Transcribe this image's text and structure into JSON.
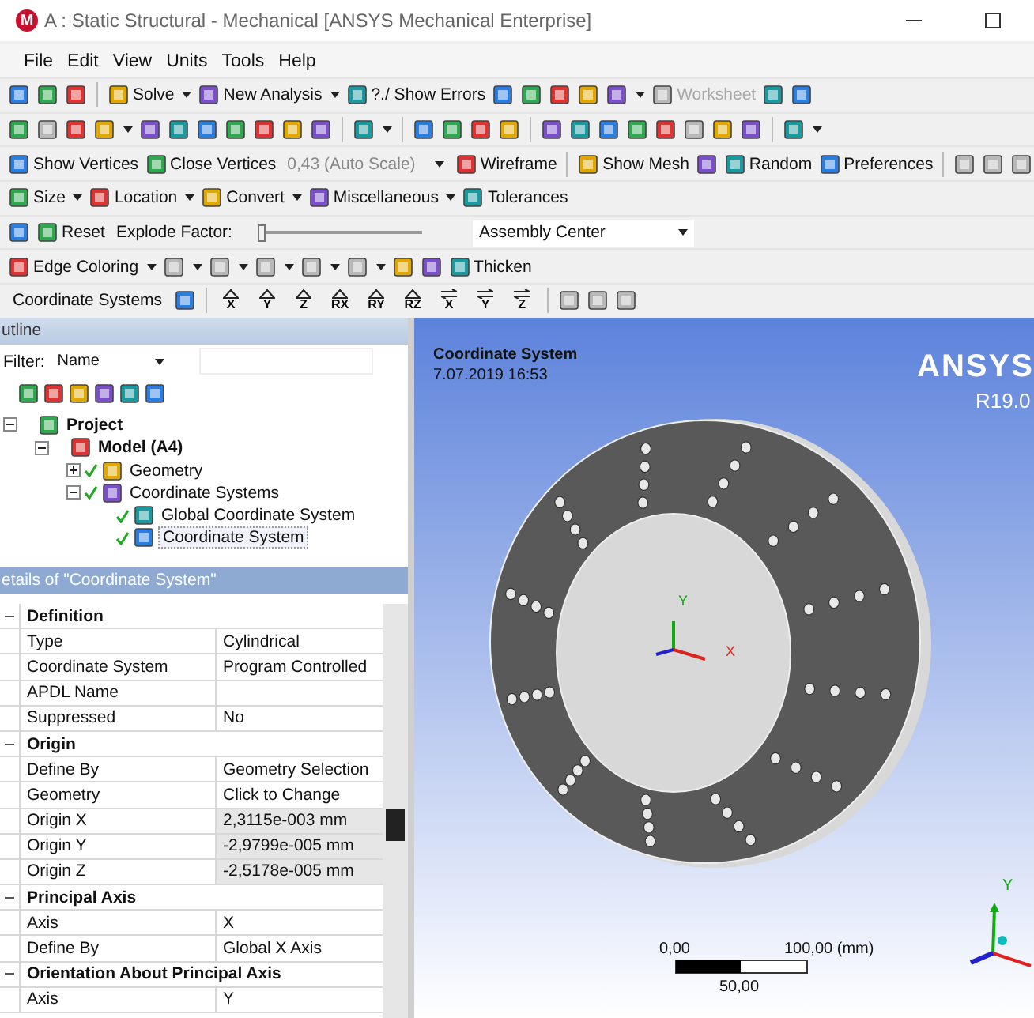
{
  "window": {
    "app_icon_letter": "M",
    "title": "A : Static Structural - Mechanical [ANSYS Mechanical Enterprise]"
  },
  "menu": [
    "File",
    "Edit",
    "View",
    "Units",
    "Tools",
    "Help"
  ],
  "toolbars": [
    [
      {
        "kind": "button"
      },
      {
        "kind": "button"
      },
      {
        "kind": "button"
      },
      {
        "kind": "separator"
      },
      {
        "kind": "button",
        "label": "Solve",
        "dropdown": true
      },
      {
        "kind": "button",
        "label": "New Analysis",
        "dropdown": true
      },
      {
        "kind": "button",
        "label": "?./ Show Errors"
      },
      {
        "kind": "button"
      },
      {
        "kind": "button"
      },
      {
        "kind": "button"
      },
      {
        "kind": "button"
      },
      {
        "kind": "button",
        "dropdown": true
      },
      {
        "kind": "button",
        "label": "Worksheet",
        "disabled": true
      },
      {
        "kind": "button"
      },
      {
        "kind": "button"
      }
    ],
    [
      {
        "kind": "button"
      },
      {
        "kind": "button",
        "disabled": true
      },
      {
        "kind": "button"
      },
      {
        "kind": "button",
        "dropdown": true
      },
      {
        "kind": "button"
      },
      {
        "kind": "button"
      },
      {
        "kind": "button"
      },
      {
        "kind": "button"
      },
      {
        "kind": "button"
      },
      {
        "kind": "button"
      },
      {
        "kind": "button"
      },
      {
        "kind": "separator"
      },
      {
        "kind": "button",
        "dropdown": true
      },
      {
        "kind": "separator"
      },
      {
        "kind": "button"
      },
      {
        "kind": "button"
      },
      {
        "kind": "button"
      },
      {
        "kind": "button"
      },
      {
        "kind": "separator"
      },
      {
        "kind": "button"
      },
      {
        "kind": "button"
      },
      {
        "kind": "button"
      },
      {
        "kind": "button"
      },
      {
        "kind": "button"
      },
      {
        "kind": "button",
        "disabled": true
      },
      {
        "kind": "button"
      },
      {
        "kind": "button"
      },
      {
        "kind": "separator"
      },
      {
        "kind": "button",
        "dropdown": true
      }
    ],
    [
      {
        "kind": "button",
        "label": "Show Vertices"
      },
      {
        "kind": "button",
        "label": "Close Vertices"
      },
      {
        "kind": "combo",
        "value": "0,43 (Auto Scale)",
        "disabled": true
      },
      {
        "kind": "button",
        "label": "Wireframe"
      },
      {
        "kind": "separator"
      },
      {
        "kind": "button",
        "label": "Show Mesh"
      },
      {
        "kind": "button"
      },
      {
        "kind": "button",
        "label": "Random"
      },
      {
        "kind": "button",
        "label": "Preferences"
      },
      {
        "kind": "separator"
      },
      {
        "kind": "button",
        "disabled": true
      },
      {
        "kind": "button",
        "disabled": true
      },
      {
        "kind": "button",
        "disabled": true
      }
    ],
    [
      {
        "kind": "button",
        "label": "Size",
        "dropdown": true
      },
      {
        "kind": "button",
        "label": "Location",
        "dropdown": true
      },
      {
        "kind": "button",
        "label": "Convert",
        "dropdown": true
      },
      {
        "kind": "button",
        "label": "Miscellaneous",
        "dropdown": true
      },
      {
        "kind": "button",
        "label": "Tolerances"
      }
    ],
    [
      {
        "kind": "button"
      },
      {
        "kind": "button",
        "label": "Reset"
      },
      {
        "kind": "text",
        "label": "Explode Factor:"
      },
      {
        "kind": "slider",
        "level": 0
      },
      {
        "kind": "combo",
        "value": "Assembly Center"
      }
    ],
    [
      {
        "kind": "button",
        "label": "Edge Coloring",
        "dropdown": true
      },
      {
        "kind": "button",
        "dropdown": true,
        "disabled": true
      },
      {
        "kind": "button",
        "dropdown": true,
        "disabled": true
      },
      {
        "kind": "button",
        "dropdown": true,
        "disabled": true
      },
      {
        "kind": "button",
        "dropdown": true,
        "disabled": true
      },
      {
        "kind": "button",
        "dropdown": true,
        "disabled": true
      },
      {
        "kind": "button"
      },
      {
        "kind": "button"
      },
      {
        "kind": "button",
        "label": "Thicken"
      }
    ],
    [
      {
        "kind": "text",
        "label": "Coordinate Systems"
      },
      {
        "kind": "button"
      },
      {
        "kind": "separator"
      },
      {
        "kind": "axis",
        "label": "X"
      },
      {
        "kind": "axis",
        "label": "Y"
      },
      {
        "kind": "axis",
        "label": "Z"
      },
      {
        "kind": "axis",
        "label": "RX"
      },
      {
        "kind": "axis",
        "label": "RY"
      },
      {
        "kind": "axis",
        "label": "RZ"
      },
      {
        "kind": "flip",
        "label": "X"
      },
      {
        "kind": "flip",
        "label": "Y"
      },
      {
        "kind": "flip",
        "label": "Z"
      },
      {
        "kind": "separator"
      },
      {
        "kind": "button",
        "disabled": true
      },
      {
        "kind": "button",
        "disabled": true
      },
      {
        "kind": "button",
        "disabled": true
      }
    ]
  ],
  "outline": {
    "title": "utline",
    "filter_label": "Filter:",
    "filter_value": "Name",
    "tree": [
      {
        "label": "Project",
        "selected": false,
        "expanded": true,
        "children": [
          {
            "label": "Model (A4)",
            "selected": false,
            "expanded": true,
            "children": [
              {
                "label": "Geometry",
                "checked": true,
                "selected": false,
                "expanded": false
              },
              {
                "label": "Coordinate Systems",
                "checked": true,
                "selected": false,
                "expanded": true,
                "children": [
                  {
                    "label": "Global Coordinate System",
                    "checked": true,
                    "selected": false
                  },
                  {
                    "label": "Coordinate System",
                    "checked": true,
                    "selected": true
                  }
                ]
              }
            ]
          }
        ]
      }
    ]
  },
  "details": {
    "title": "etails of \"Coordinate System\"",
    "sections": [
      {
        "name": "Definition",
        "expanded": true,
        "rows": [
          {
            "name": "Type",
            "value": "Cylindrical",
            "shaded": false
          },
          {
            "name": "Coordinate System",
            "value": "Program Controlled",
            "shaded": false
          },
          {
            "name": "APDL Name",
            "shaded": false
          },
          {
            "name": "Suppressed",
            "value": "No",
            "shaded": false
          }
        ]
      },
      {
        "name": "Origin",
        "expanded": true,
        "rows": [
          {
            "name": "Define By",
            "value": "Geometry Selection",
            "shaded": false
          },
          {
            "name": "Geometry",
            "value": "Click to Change",
            "shaded": false
          },
          {
            "name": "Origin X",
            "value": "2,3115e-003 mm",
            "shaded": true
          },
          {
            "name": "Origin Y",
            "value": "-2,9799e-005 mm",
            "shaded": true
          },
          {
            "name": "Origin Z",
            "value": "-2,5178e-005 mm",
            "shaded": true
          }
        ]
      },
      {
        "name": "Principal Axis",
        "expanded": true,
        "rows": [
          {
            "name": "Axis",
            "value": "X",
            "shaded": false
          },
          {
            "name": "Define By",
            "value": "Global X Axis",
            "shaded": false
          }
        ]
      },
      {
        "name": "Orientation About Principal Axis",
        "expanded": true,
        "rows": [
          {
            "name": "Axis",
            "value": "Y",
            "shaded": false
          }
        ]
      }
    ]
  },
  "viewport": {
    "title": "Coordinate System",
    "date": "7.07.2019 16:53",
    "brand": "ANSYS",
    "version": "R19.0",
    "model_triad": {
      "y": "Y",
      "x": "X"
    },
    "scale": {
      "start": "0,00",
      "end": "100,00 (mm)",
      "middle": "50,00"
    },
    "corner_triad": {
      "y": "Y"
    }
  }
}
